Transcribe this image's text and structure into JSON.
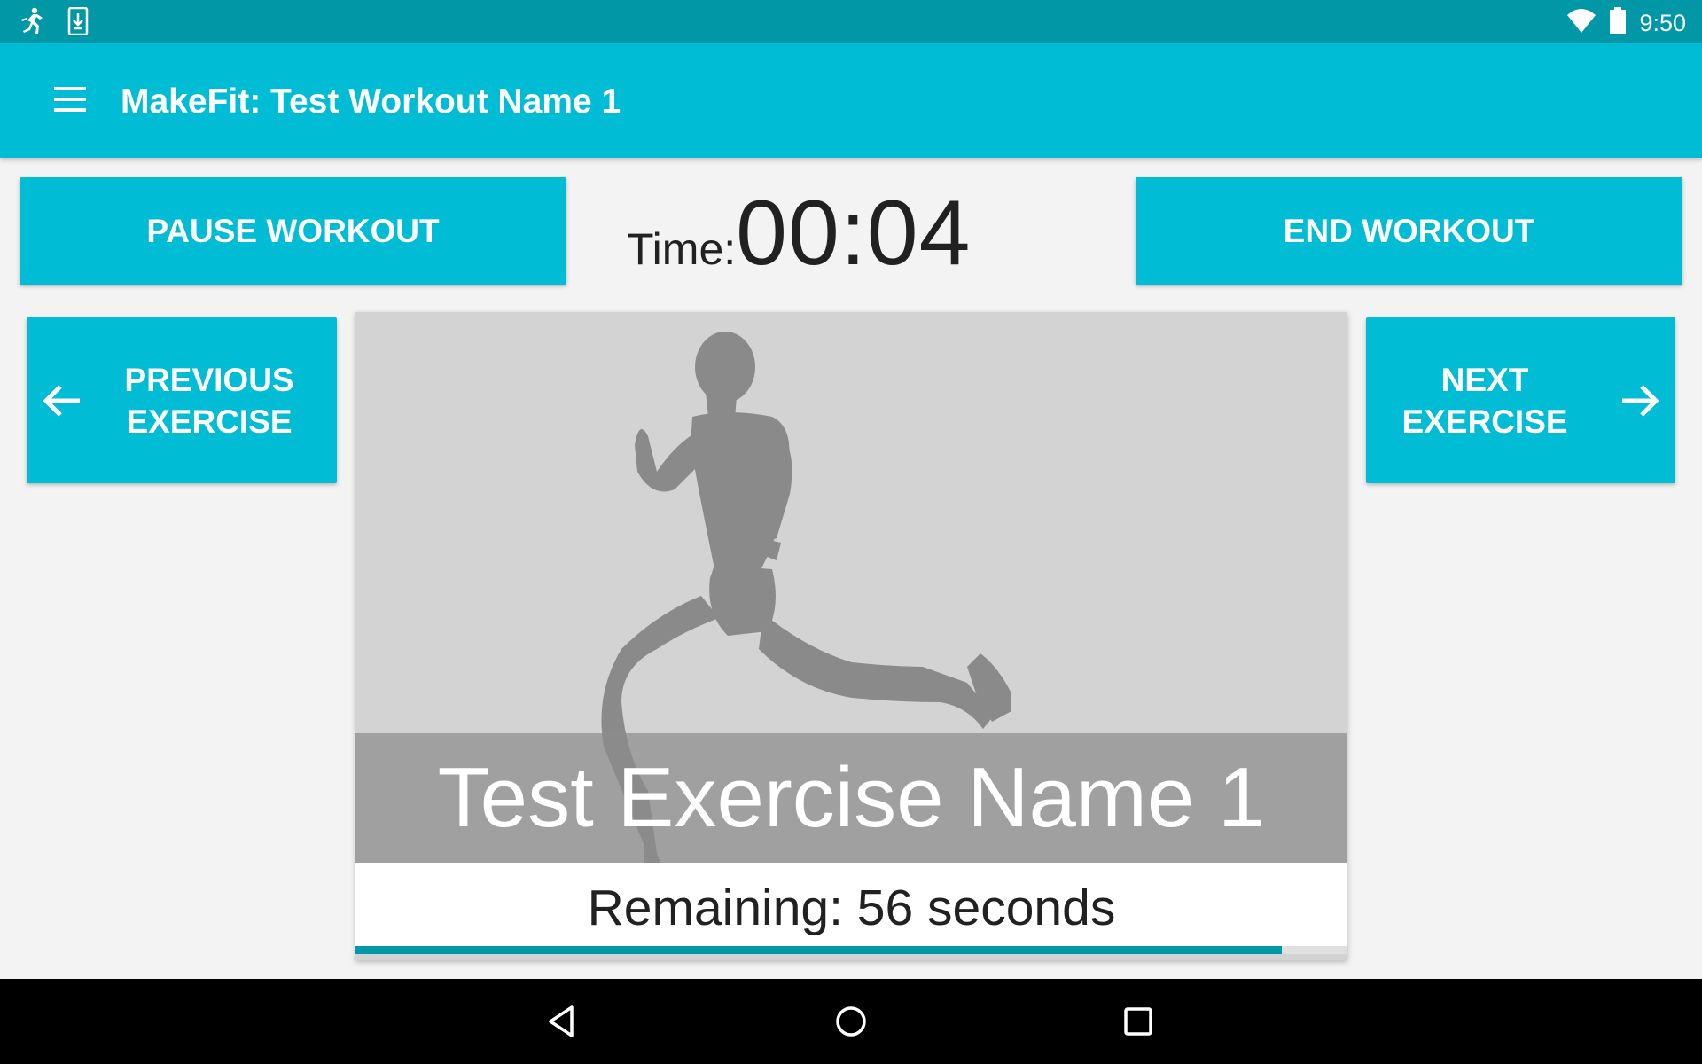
{
  "status_bar": {
    "left_icons": [
      "runner-notification-icon",
      "download-notification-icon"
    ],
    "right_icons": [
      "wifi-icon",
      "battery-icon"
    ],
    "time": "9:50"
  },
  "app_bar": {
    "menu_icon": "hamburger-menu-icon",
    "title": "MakeFit: Test Workout Name 1",
    "background": "#00bcd4"
  },
  "controls": {
    "pause_label": "PAUSE WORKOUT",
    "end_label": "END WORKOUT",
    "timer_label": "Time:",
    "timer_value": "00:04",
    "previous_label_line1": "PREVIOUS",
    "previous_label_line2": "EXERCISE",
    "next_label_line1": "NEXT",
    "next_label_line2": "EXERCISE",
    "previous_icon": "arrow-left-icon",
    "next_icon": "arrow-right-icon"
  },
  "exercise": {
    "image": "running-man-silhouette",
    "name": "Test Exercise Name 1",
    "remaining_text": "Remaining: 56 seconds",
    "progress": 0.934
  },
  "nav_bar": {
    "icons": [
      "back-triangle-icon",
      "home-circle-icon",
      "recents-square-icon"
    ]
  },
  "colors": {
    "accent": "#00bcd4",
    "status_bar": "#0097a7",
    "progress": "#0097a7"
  }
}
